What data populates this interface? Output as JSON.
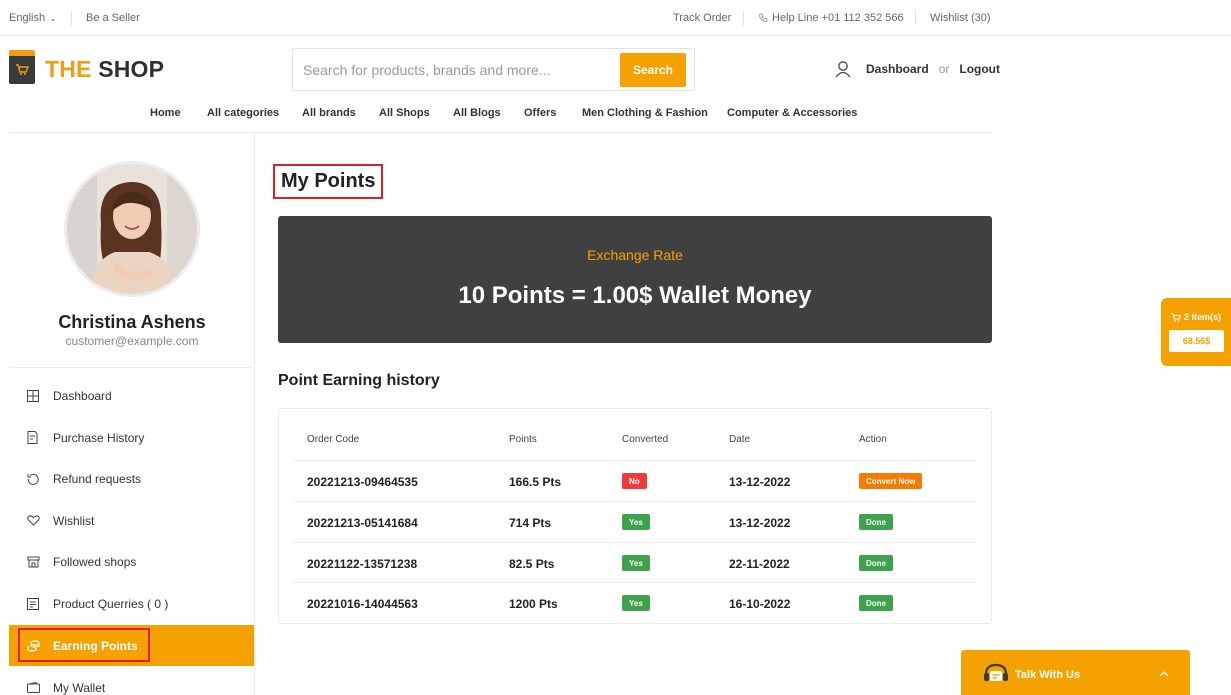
{
  "topbar": {
    "language": "English",
    "be_seller": "Be a Seller",
    "track_order": "Track Order",
    "helpline": "Help Line +01 112 352 566",
    "wishlist": "Wishlist (30)"
  },
  "brand": {
    "the": "THE",
    "shop": "SHOP",
    "accent": "#f39c12"
  },
  "search": {
    "placeholder": "Search for products, brands and more...",
    "button": "Search"
  },
  "account": {
    "dashboard": "Dashboard",
    "or": "or",
    "logout": "Logout"
  },
  "nav": [
    "Home",
    "All categories",
    "All brands",
    "All Shops",
    "All Blogs",
    "Offers",
    "Men Clothing & Fashion",
    "Computer & Accessories"
  ],
  "profile": {
    "name": "Christina Ashens",
    "email": "customer@example.com"
  },
  "menu": [
    {
      "label": "Dashboard",
      "icon": "dashboard-icon"
    },
    {
      "label": "Purchase History",
      "icon": "purchase-history-icon"
    },
    {
      "label": "Refund requests",
      "icon": "refund-icon"
    },
    {
      "label": "Wishlist",
      "icon": "heart-icon"
    },
    {
      "label": "Followed shops",
      "icon": "shop-icon"
    },
    {
      "label": "Product Querries ( 0 )",
      "icon": "query-icon"
    },
    {
      "label": "Earning Points",
      "icon": "points-icon",
      "active": true
    },
    {
      "label": "My Wallet",
      "icon": "wallet-icon"
    }
  ],
  "main": {
    "title": "My Points",
    "exchange": {
      "label": "Exchange Rate",
      "value": "10 Points = 1.00$ Wallet Money"
    },
    "history_title": "Point Earning history",
    "columns": [
      "Order Code",
      "Points",
      "Converted",
      "Date",
      "Action"
    ],
    "rows": [
      {
        "code": "20221213-09464535",
        "points": "166.5 Pts",
        "converted": "No",
        "date": "13-12-2022",
        "action": "Convert Now"
      },
      {
        "code": "20221213-05141684",
        "points": "714 Pts",
        "converted": "Yes",
        "date": "13-12-2022",
        "action": "Done"
      },
      {
        "code": "20221122-13571238",
        "points": "82.5 Pts",
        "converted": "Yes",
        "date": "22-11-2022",
        "action": "Done"
      },
      {
        "code": "20221016-14044563",
        "points": "1200 Pts",
        "converted": "Yes",
        "date": "16-10-2022",
        "action": "Done"
      }
    ]
  },
  "cart": {
    "items": "2 item(s)",
    "amount": "68.56$"
  },
  "chat": {
    "label": "Talk With Us"
  },
  "colors": {
    "accent": "#f5a200",
    "dark_card": "#404040",
    "no": "#ef3b3b",
    "yes": "#3fa34d",
    "convert": "#f57c00"
  }
}
